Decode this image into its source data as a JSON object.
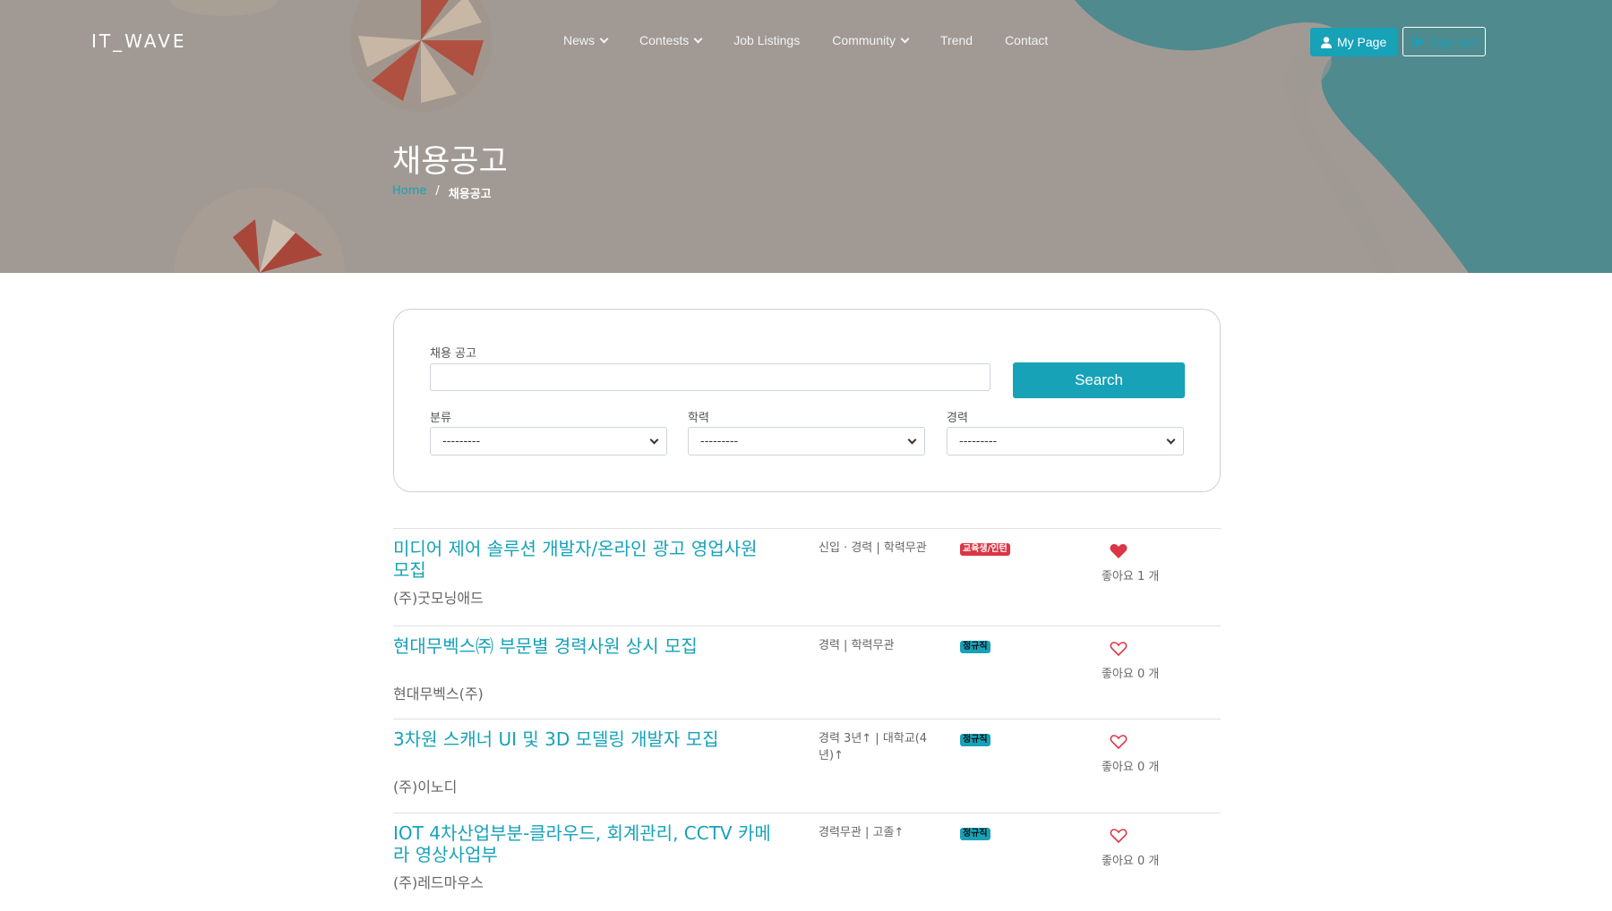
{
  "brand": "IT_WAVE",
  "nav": {
    "items": [
      {
        "label": "News",
        "dropdown": true
      },
      {
        "label": "Contests",
        "dropdown": true
      },
      {
        "label": "Job Listings",
        "dropdown": false
      },
      {
        "label": "Community",
        "dropdown": true
      },
      {
        "label": "Trend",
        "dropdown": false
      },
      {
        "label": "Contact",
        "dropdown": false
      }
    ],
    "mypage_label": "My Page",
    "signout_label": "Sign out"
  },
  "hero": {
    "title": "채용공고",
    "breadcrumb_home": "Home",
    "breadcrumb_sep": "/",
    "breadcrumb_current": "채용공고"
  },
  "search": {
    "job_label": "채용 공고",
    "job_value": "",
    "button_label": "Search",
    "category_label": "분류",
    "category_value": "---------",
    "education_label": "학력",
    "education_value": "---------",
    "career_label": "경력",
    "career_value": "---------"
  },
  "jobs": [
    {
      "title_line1": "미디어 제어 솔루션 개발자/온라인 광고 영업사원",
      "title_line2": "모집",
      "company": "(주)굿모닝애드",
      "meta_line1": "신입 · 경력 | 학력무관",
      "meta_line2": "",
      "badge": "교육생/인턴",
      "badge_color": "#dc3545",
      "liked": true,
      "likes": "좋아요 1 개"
    },
    {
      "title_line1": "현대무벡스㈜ 부문별 경력사원 상시 모집",
      "title_line2": "",
      "company": "현대무벡스(주)",
      "meta_line1": "경력 | 학력무관",
      "meta_line2": "",
      "badge": "정규직",
      "badge_color": "#17a2b8",
      "liked": false,
      "likes": "좋아요 0 개"
    },
    {
      "title_line1": "3차원 스캐너 UI 및 3D 모델링 개발자 모집",
      "title_line2": "",
      "company": "(주)이노디",
      "meta_line1": "경력 3년↑ | 대학교(4",
      "meta_line2": "년)↑",
      "badge": "정규직",
      "badge_color": "#17a2b8",
      "liked": false,
      "likes": "좋아요 0 개"
    },
    {
      "title_line1": "IOT 4차산업부분-클라우드, 회계관리, CCTV 카메",
      "title_line2": "라 영상사업부",
      "company": "(주)레드마우스",
      "meta_line1": "경력무관 | 고졸↑",
      "meta_line2": "",
      "badge": "정규직",
      "badge_color": "#17a2b8",
      "liked": false,
      "likes": "좋아요 0 개"
    }
  ],
  "colors": {
    "accent": "#17a2b8",
    "heart": "#dc3545",
    "badge_intern": "#dc3545"
  }
}
